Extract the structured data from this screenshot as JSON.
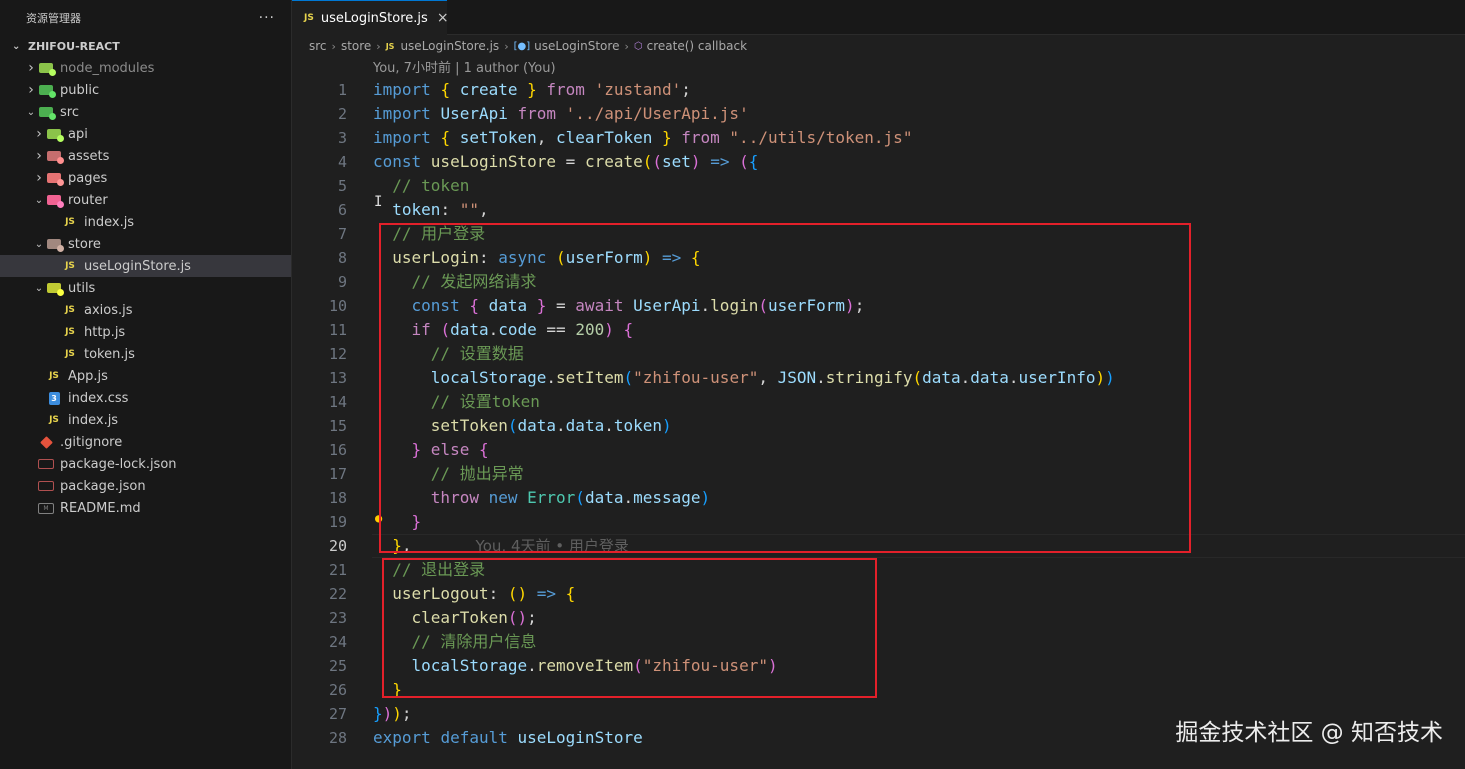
{
  "sidebar": {
    "title": "资源管理器",
    "more": "···",
    "project": "ZHIFOU-REACT",
    "items": [
      {
        "label": "node_modules",
        "kind": "folder",
        "depth": 1,
        "expanded": false,
        "icon": "node-folder-icon",
        "color": "#8bc34a"
      },
      {
        "label": "public",
        "kind": "folder",
        "depth": 1,
        "expanded": false,
        "icon": "public-folder-icon",
        "color": "#4caf50"
      },
      {
        "label": "src",
        "kind": "folder",
        "depth": 1,
        "expanded": true,
        "icon": "src-folder-icon",
        "color": "#4caf50"
      },
      {
        "label": "api",
        "kind": "folder",
        "depth": 2,
        "expanded": false,
        "icon": "api-folder-icon",
        "color": "#8bc34a"
      },
      {
        "label": "assets",
        "kind": "folder",
        "depth": 2,
        "expanded": false,
        "icon": "assets-folder-icon",
        "color": "#c66e6e"
      },
      {
        "label": "pages",
        "kind": "folder",
        "depth": 2,
        "expanded": false,
        "icon": "pages-folder-icon",
        "color": "#e57373"
      },
      {
        "label": "router",
        "kind": "folder",
        "depth": 2,
        "expanded": true,
        "icon": "router-folder-icon",
        "color": "#f06292"
      },
      {
        "label": "index.js",
        "kind": "js",
        "depth": 3
      },
      {
        "label": "store",
        "kind": "folder",
        "depth": 2,
        "expanded": true,
        "icon": "store-folder-icon",
        "color": "#a1887f"
      },
      {
        "label": "useLoginStore.js",
        "kind": "js",
        "depth": 3,
        "selected": true
      },
      {
        "label": "utils",
        "kind": "folder",
        "depth": 2,
        "expanded": true,
        "icon": "utils-folder-icon",
        "color": "#c0ca33"
      },
      {
        "label": "axios.js",
        "kind": "js",
        "depth": 3
      },
      {
        "label": "http.js",
        "kind": "js",
        "depth": 3
      },
      {
        "label": "token.js",
        "kind": "js",
        "depth": 3
      },
      {
        "label": "App.js",
        "kind": "js",
        "depth": 2
      },
      {
        "label": "index.css",
        "kind": "css",
        "depth": 2
      },
      {
        "label": "index.js",
        "kind": "js",
        "depth": 2
      },
      {
        "label": ".gitignore",
        "kind": "git",
        "depth": 1
      },
      {
        "label": "package-lock.json",
        "kind": "json",
        "depth": 1
      },
      {
        "label": "package.json",
        "kind": "json",
        "depth": 1
      },
      {
        "label": "README.md",
        "kind": "md",
        "depth": 1
      }
    ]
  },
  "tab": {
    "label": "useLoginStore.js",
    "icon": "JS",
    "close": "×"
  },
  "breadcrumb": {
    "parts": [
      "src",
      "store",
      "useLoginStore.js",
      "useLoginStore",
      "create() callback"
    ]
  },
  "blame": "You, 7小时前 | 1 author (You)",
  "inline_blame": "You, 4天前 • 用户登录",
  "current_line": 20,
  "code_lines": [
    [
      [
        "k",
        "import "
      ],
      [
        "b1",
        "{ "
      ],
      [
        "v",
        "create"
      ],
      [
        "b1",
        " }"
      ],
      [
        "c",
        " from "
      ],
      [
        "s",
        "'zustand'"
      ],
      [
        "p",
        ";"
      ]
    ],
    [
      [
        "k",
        "import "
      ],
      [
        "v",
        "UserApi"
      ],
      [
        "c",
        " from "
      ],
      [
        "s",
        "'../api/UserApi.js'"
      ]
    ],
    [
      [
        "k",
        "import "
      ],
      [
        "b1",
        "{ "
      ],
      [
        "v",
        "setToken"
      ],
      [
        "p",
        ", "
      ],
      [
        "v",
        "clearToken"
      ],
      [
        "b1",
        " }"
      ],
      [
        "c",
        " from "
      ],
      [
        "s",
        "\"../utils/token.js\""
      ]
    ],
    [
      [
        "k",
        "const "
      ],
      [
        "f",
        "useLoginStore"
      ],
      [
        "p",
        " = "
      ],
      [
        "f",
        "create"
      ],
      [
        "b1",
        "("
      ],
      [
        "b2",
        "("
      ],
      [
        "v",
        "set"
      ],
      [
        "b2",
        ")"
      ],
      [
        "k",
        " => "
      ],
      [
        "b2",
        "("
      ],
      [
        "b3",
        "{"
      ]
    ],
    [
      [
        "cm",
        "  // token"
      ]
    ],
    [
      [
        "v",
        "  token"
      ],
      [
        "p",
        ": "
      ],
      [
        "s",
        "\"\""
      ],
      [
        "p",
        ","
      ]
    ],
    [
      [
        "cm",
        "  // 用户登录"
      ]
    ],
    [
      [
        "f",
        "  userLogin"
      ],
      [
        "p",
        ": "
      ],
      [
        "k",
        "async "
      ],
      [
        "b1",
        "("
      ],
      [
        "v",
        "userForm"
      ],
      [
        "b1",
        ")"
      ],
      [
        "k",
        " => "
      ],
      [
        "b1",
        "{"
      ]
    ],
    [
      [
        "cm",
        "    // 发起网络请求"
      ]
    ],
    [
      [
        "k",
        "    const "
      ],
      [
        "b2",
        "{ "
      ],
      [
        "v",
        "data"
      ],
      [
        "b2",
        " }"
      ],
      [
        "p",
        " = "
      ],
      [
        "c",
        "await "
      ],
      [
        "v",
        "UserApi"
      ],
      [
        "p",
        "."
      ],
      [
        "f",
        "login"
      ],
      [
        "b2",
        "("
      ],
      [
        "v",
        "userForm"
      ],
      [
        "b2",
        ")"
      ],
      [
        "p",
        ";"
      ]
    ],
    [
      [
        "c",
        "    if "
      ],
      [
        "b2",
        "("
      ],
      [
        "v",
        "data"
      ],
      [
        "p",
        "."
      ],
      [
        "v",
        "code"
      ],
      [
        "p",
        " == "
      ],
      [
        "n",
        "200"
      ],
      [
        "b2",
        ")"
      ],
      [
        "p",
        " "
      ],
      [
        "b2",
        "{"
      ]
    ],
    [
      [
        "cm",
        "      // 设置数据"
      ]
    ],
    [
      [
        "v",
        "      localStorage"
      ],
      [
        "p",
        "."
      ],
      [
        "f",
        "setItem"
      ],
      [
        "b3",
        "("
      ],
      [
        "s",
        "\"zhifou-user\""
      ],
      [
        "p",
        ", "
      ],
      [
        "v",
        "JSON"
      ],
      [
        "p",
        "."
      ],
      [
        "f",
        "stringify"
      ],
      [
        "b1",
        "("
      ],
      [
        "v",
        "data"
      ],
      [
        "p",
        "."
      ],
      [
        "v",
        "data"
      ],
      [
        "p",
        "."
      ],
      [
        "v",
        "userInfo"
      ],
      [
        "b1",
        ")"
      ],
      [
        "b3",
        ")"
      ]
    ],
    [
      [
        "cm",
        "      // 设置token"
      ]
    ],
    [
      [
        "f",
        "      setToken"
      ],
      [
        "b3",
        "("
      ],
      [
        "v",
        "data"
      ],
      [
        "p",
        "."
      ],
      [
        "v",
        "data"
      ],
      [
        "p",
        "."
      ],
      [
        "v",
        "token"
      ],
      [
        "b3",
        ")"
      ]
    ],
    [
      [
        "b2",
        "    }"
      ],
      [
        "c",
        " else "
      ],
      [
        "b2",
        "{"
      ]
    ],
    [
      [
        "cm",
        "      // 抛出异常"
      ]
    ],
    [
      [
        "c",
        "      throw "
      ],
      [
        "k",
        "new "
      ],
      [
        "t",
        "Error"
      ],
      [
        "b3",
        "("
      ],
      [
        "v",
        "data"
      ],
      [
        "p",
        "."
      ],
      [
        "v",
        "message"
      ],
      [
        "b3",
        ")"
      ]
    ],
    [
      [
        "p",
        "    "
      ],
      [
        "b2",
        "}"
      ]
    ],
    [
      [
        "b1",
        "  }"
      ],
      [
        "p",
        ","
      ]
    ],
    [
      [
        "cm",
        "  // 退出登录"
      ]
    ],
    [
      [
        "f",
        "  userLogout"
      ],
      [
        "p",
        ": "
      ],
      [
        "b1",
        "()"
      ],
      [
        "k",
        " => "
      ],
      [
        "b1",
        "{"
      ]
    ],
    [
      [
        "f",
        "    clearToken"
      ],
      [
        "b2",
        "()"
      ],
      [
        "p",
        ";"
      ]
    ],
    [
      [
        "cm",
        "    // 清除用户信息"
      ]
    ],
    [
      [
        "v",
        "    localStorage"
      ],
      [
        "p",
        "."
      ],
      [
        "f",
        "removeItem"
      ],
      [
        "b2",
        "("
      ],
      [
        "s",
        "\"zhifou-user\""
      ],
      [
        "b2",
        ")"
      ]
    ],
    [
      [
        "b1",
        "  }"
      ]
    ],
    [
      [
        "b3",
        "}"
      ],
      [
        "b2",
        ")"
      ],
      [
        "b1",
        ")"
      ],
      [
        "p",
        ";"
      ]
    ],
    [
      [
        "k",
        "export "
      ],
      [
        "k",
        "default "
      ],
      [
        "v",
        "useLoginStore"
      ]
    ]
  ],
  "watermark": "掘金技术社区 @ 知否技术"
}
